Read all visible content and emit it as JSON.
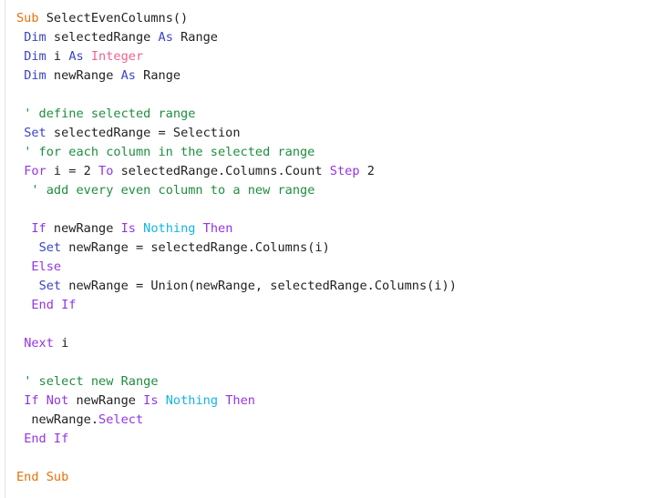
{
  "editor": {
    "language": "VBA",
    "background": "#ffffff",
    "gutter_rule_color": "#e3e3e6",
    "palette": {
      "keyword": "#9334e6",
      "procedure": "#e8710a",
      "declaration": "#3a45c4",
      "type": "#f06292",
      "constant": "#12b5e5",
      "comment": "#1e8e3e",
      "plain": "#202124"
    }
  },
  "code": {
    "lines": [
      {
        "tokens": [
          {
            "t": "Sub",
            "c": "sub"
          },
          {
            "t": " SelectEvenColumns()",
            "c": "plain"
          }
        ]
      },
      {
        "tokens": [
          {
            "t": " ",
            "c": "plain"
          },
          {
            "t": "Dim",
            "c": "decl"
          },
          {
            "t": " selectedRange ",
            "c": "plain"
          },
          {
            "t": "As",
            "c": "decl"
          },
          {
            "t": " Range",
            "c": "plain"
          }
        ]
      },
      {
        "tokens": [
          {
            "t": " ",
            "c": "plain"
          },
          {
            "t": "Dim",
            "c": "decl"
          },
          {
            "t": " i ",
            "c": "plain"
          },
          {
            "t": "As",
            "c": "decl"
          },
          {
            "t": " ",
            "c": "plain"
          },
          {
            "t": "Integer",
            "c": "type"
          }
        ]
      },
      {
        "tokens": [
          {
            "t": " ",
            "c": "plain"
          },
          {
            "t": "Dim",
            "c": "decl"
          },
          {
            "t": " newRange ",
            "c": "plain"
          },
          {
            "t": "As",
            "c": "decl"
          },
          {
            "t": " Range",
            "c": "plain"
          }
        ]
      },
      {
        "tokens": []
      },
      {
        "tokens": [
          {
            "t": " ",
            "c": "plain"
          },
          {
            "t": "' define selected range",
            "c": "comment"
          }
        ]
      },
      {
        "tokens": [
          {
            "t": " ",
            "c": "plain"
          },
          {
            "t": "Set",
            "c": "decl"
          },
          {
            "t": " selectedRange = Selection",
            "c": "plain"
          }
        ]
      },
      {
        "tokens": [
          {
            "t": " ",
            "c": "plain"
          },
          {
            "t": "' for each column in the selected range",
            "c": "comment"
          }
        ]
      },
      {
        "tokens": [
          {
            "t": " ",
            "c": "plain"
          },
          {
            "t": "For",
            "c": "kw"
          },
          {
            "t": " i = 2 ",
            "c": "plain"
          },
          {
            "t": "To",
            "c": "kw"
          },
          {
            "t": " selectedRange.Columns.Count ",
            "c": "plain"
          },
          {
            "t": "Step",
            "c": "kw"
          },
          {
            "t": " 2",
            "c": "plain"
          }
        ]
      },
      {
        "tokens": [
          {
            "t": "  ",
            "c": "plain"
          },
          {
            "t": "' add every even column to a new range",
            "c": "comment"
          }
        ]
      },
      {
        "tokens": []
      },
      {
        "tokens": [
          {
            "t": "  ",
            "c": "plain"
          },
          {
            "t": "If",
            "c": "kw"
          },
          {
            "t": " newRange ",
            "c": "plain"
          },
          {
            "t": "Is",
            "c": "kw"
          },
          {
            "t": " ",
            "c": "plain"
          },
          {
            "t": "Nothing",
            "c": "const"
          },
          {
            "t": " ",
            "c": "plain"
          },
          {
            "t": "Then",
            "c": "kw"
          }
        ]
      },
      {
        "tokens": [
          {
            "t": "   ",
            "c": "plain"
          },
          {
            "t": "Set",
            "c": "decl"
          },
          {
            "t": " newRange = selectedRange.Columns(i)",
            "c": "plain"
          }
        ]
      },
      {
        "tokens": [
          {
            "t": "  ",
            "c": "plain"
          },
          {
            "t": "Else",
            "c": "kw"
          }
        ]
      },
      {
        "tokens": [
          {
            "t": "   ",
            "c": "plain"
          },
          {
            "t": "Set",
            "c": "decl"
          },
          {
            "t": " newRange = Union(newRange, selectedRange.Columns(i))",
            "c": "plain"
          }
        ]
      },
      {
        "tokens": [
          {
            "t": "  ",
            "c": "plain"
          },
          {
            "t": "End If",
            "c": "kw"
          }
        ]
      },
      {
        "tokens": []
      },
      {
        "tokens": [
          {
            "t": " ",
            "c": "plain"
          },
          {
            "t": "Next",
            "c": "kw"
          },
          {
            "t": " i",
            "c": "plain"
          }
        ]
      },
      {
        "tokens": []
      },
      {
        "tokens": [
          {
            "t": " ",
            "c": "plain"
          },
          {
            "t": "' select new Range",
            "c": "comment"
          }
        ]
      },
      {
        "tokens": [
          {
            "t": " ",
            "c": "plain"
          },
          {
            "t": "If",
            "c": "kw"
          },
          {
            "t": " ",
            "c": "plain"
          },
          {
            "t": "Not",
            "c": "kw"
          },
          {
            "t": " newRange ",
            "c": "plain"
          },
          {
            "t": "Is",
            "c": "kw"
          },
          {
            "t": " ",
            "c": "plain"
          },
          {
            "t": "Nothing",
            "c": "const"
          },
          {
            "t": " ",
            "c": "plain"
          },
          {
            "t": "Then",
            "c": "kw"
          }
        ]
      },
      {
        "tokens": [
          {
            "t": "  newRange.",
            "c": "plain"
          },
          {
            "t": "Select",
            "c": "kw"
          }
        ]
      },
      {
        "tokens": [
          {
            "t": " ",
            "c": "plain"
          },
          {
            "t": "End If",
            "c": "kw"
          }
        ]
      },
      {
        "tokens": []
      },
      {
        "tokens": [
          {
            "t": "End Sub",
            "c": "sub"
          }
        ]
      }
    ]
  }
}
